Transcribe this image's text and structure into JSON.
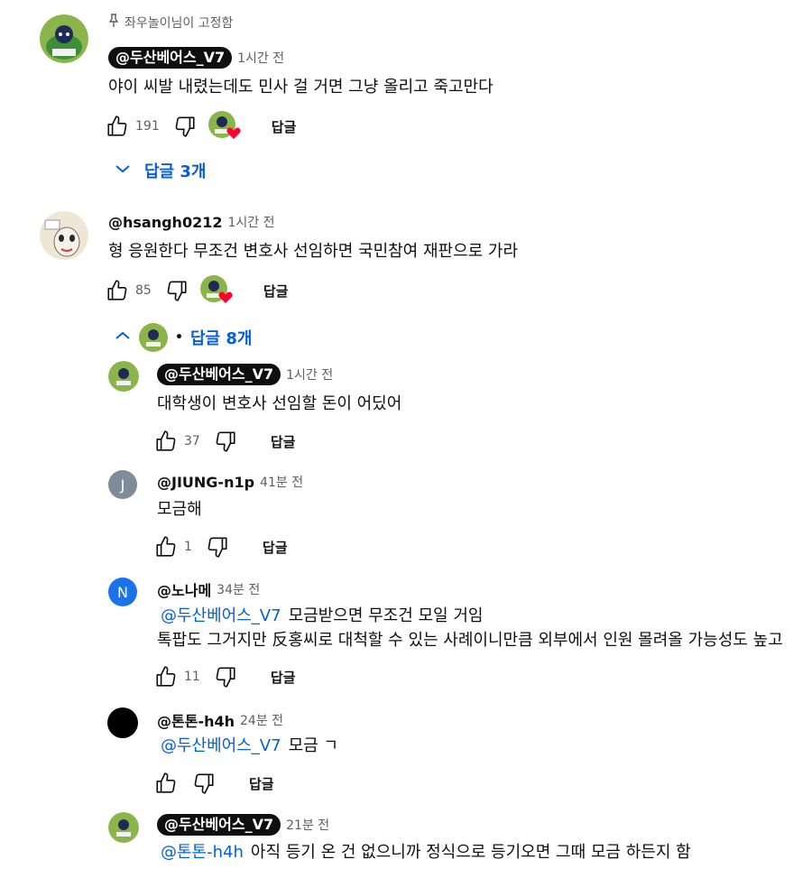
{
  "pinned": {
    "label": "좌우놀이님이 고정함"
  },
  "thread1": {
    "author": "@두산베어스_V7",
    "time": "1시간 전",
    "text": "야이 씨발 내렸는데도 민사 걸 거면 그냥 올리고 죽고만다",
    "likes": "191",
    "reply_label": "답글",
    "replies_toggle": "답글 3개"
  },
  "thread2": {
    "author": "@hsangh0212",
    "time": "1시간 전",
    "text": "형 응원한다 무조건 변호사 선임하면 국민참여 재판으로 가라",
    "likes": "85",
    "reply_label": "답글",
    "replies_toggle_sep": "•",
    "replies_toggle": "답글 8개",
    "replies": [
      {
        "author": "@두산베어스_V7",
        "time": "1시간 전",
        "text": "대학생이 변호사 선임할 돈이 어딨어",
        "likes": "37",
        "reply_label": "답글"
      },
      {
        "author": "@JIUNG-n1p",
        "time": "41분 전",
        "avatar_letter": "J",
        "text": "모금해",
        "likes": "1",
        "reply_label": "답글"
      },
      {
        "author": "@노나메",
        "time": "34분 전",
        "avatar_letter": "N",
        "mention": "@두산베어스_V7",
        "text": "모금받으면 무조건 모일 거임",
        "text2": "톡팝도 그거지만 反홍씨로 대척할 수 있는 사례이니만큼 외부에서 인원 몰려올 가능성도 높고",
        "likes": "11",
        "reply_label": "답글"
      },
      {
        "author": "@톤톤-h4h",
        "time": "24분 전",
        "mention": "@두산베어스_V7",
        "text": "모금 ㄱ",
        "likes": "",
        "reply_label": "답글"
      },
      {
        "author": "@두산베어스_V7",
        "time": "21분 전",
        "mention": "@톤톤-h4h",
        "text": "아직 등기 온 건 없으니까 정식으로 등기오면 그때 모금 하든지 함"
      }
    ]
  },
  "colors": {
    "link": "#065fd4",
    "chip_bg": "#0f0f0f",
    "muted": "#606060",
    "heart": "#ff0033"
  }
}
